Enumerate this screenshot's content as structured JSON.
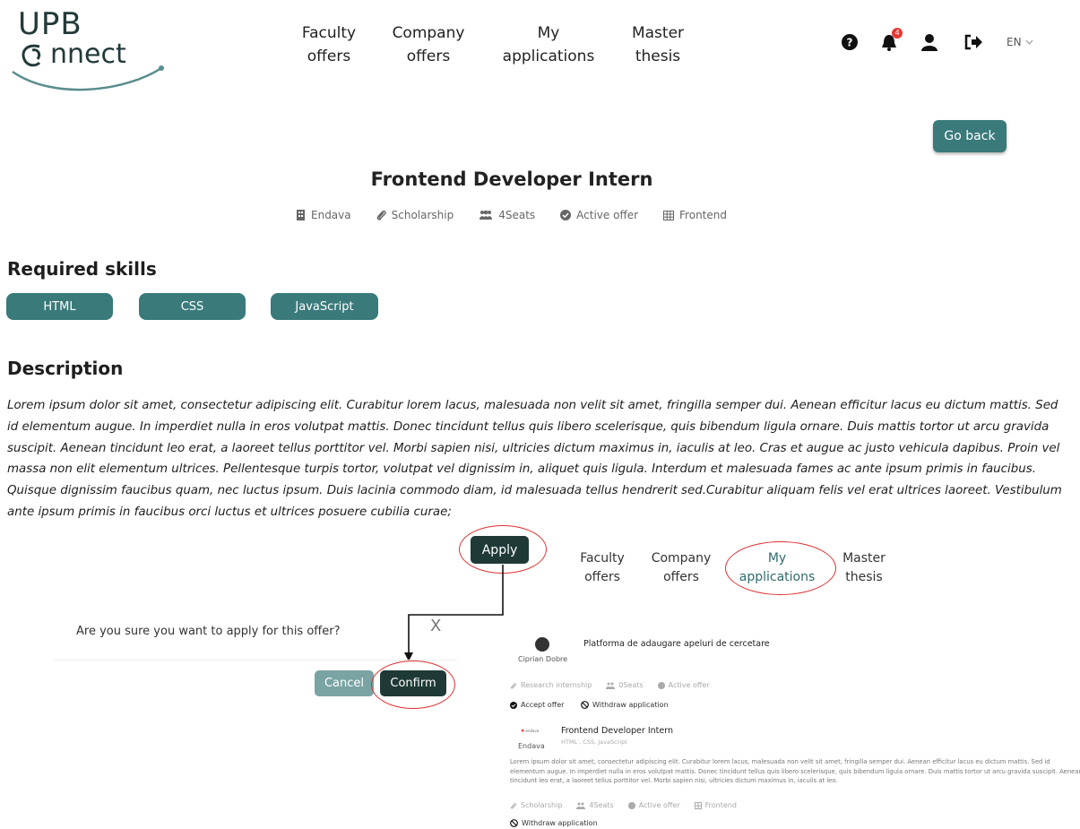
{
  "logo": {
    "line1": "UPB",
    "line2": "nnect"
  },
  "nav": [
    {
      "line1": "Faculty",
      "line2": "offers"
    },
    {
      "line1": "Company",
      "line2": "offers"
    },
    {
      "line1": "My",
      "line2": "applications"
    },
    {
      "line1": "Master",
      "line2": "thesis"
    }
  ],
  "header": {
    "notification_count": "4",
    "language": "EN"
  },
  "go_back_label": "Go back",
  "offer": {
    "title": "Frontend Developer Intern",
    "company": "Endava",
    "type": "Scholarship",
    "seats": "4Seats",
    "status": "Active offer",
    "category": "Frontend"
  },
  "skills": {
    "heading": "Required skills",
    "items": [
      "HTML",
      "CSS",
      "JavaScript"
    ]
  },
  "description": {
    "heading": "Description",
    "text": "Lorem ipsum dolor sit amet, consectetur adipiscing elit. Curabitur lorem lacus, malesuada non velit sit amet, fringilla semper dui. Aenean efficitur lacus eu dictum mattis. Sed id elementum augue. In imperdiet nulla in eros volutpat mattis. Donec tincidunt tellus quis libero scelerisque, quis bibendum ligula ornare. Duis mattis tortor ut arcu gravida suscipit. Aenean tincidunt leo erat, a laoreet tellus porttitor vel. Morbi sapien nisi, ultricies dictum maximus in, iaculis at leo. Cras et augue ac justo vehicula dapibus. Proin vel massa non elit elementum ultrices. Pellentesque turpis tortor, volutpat vel dignissim in, aliquet quis ligula. Interdum et malesuada fames ac ante ipsum primis in faucibus. Quisque dignissim faucibus quam, nec luctus ipsum. Duis lacinia commodo diam, id malesuada tellus hendrerit sed.Curabitur aliquam felis vel erat ultrices laoreet. Vestibulum ante ipsum primis in faucibus orci luctus et ultrices posuere cubilia curae;"
  },
  "apply_label": "Apply",
  "modal": {
    "question": "Are you sure you want to apply for this offer?",
    "close": "X",
    "cancel": "Cancel",
    "confirm": "Confirm"
  },
  "applications": [
    {
      "title": "Platforma de adaugare apeluri de cercetare",
      "owner": "Ciprian Dobre",
      "tags": [
        "Research internship",
        "0Seats",
        "Active offer"
      ],
      "actions": [
        "Accept offer",
        "Withdraw application"
      ]
    },
    {
      "title": "Frontend Developer Intern",
      "owner": "Endava",
      "logo_text": "endava",
      "skills": "HTML , CSS, JavaScript",
      "description": "Lorem ipsum dolor sit amet, consectetur adipiscing elit. Curabitur lorem lacus, malesuada non velit sit amet, fringilla semper dui. Aenean efficitur lacus eu dictum mattis. Sed id elementum augue. In imperdiet nulla in eros volutpat mattis. Donec tincidunt tellus quis libero scelerisque, quis bibendum ligula ornare. Duis mattis tortor ut arcu gravida suscipit. Aenean tincidunt leo erat, a laoreet tellus porttitor vel. Morbi sapien nisi, ultricies dictum maximus in, iaculis at leo.",
      "tags": [
        "Scholarship",
        "4Seats",
        "Active offer",
        "Frontend"
      ],
      "actions": [
        "Withdraw application"
      ]
    }
  ],
  "colors": {
    "teal": "#3a7a7a",
    "dark_teal": "#1f3a36",
    "highlight_red": "#e03030",
    "badge_red": "#e53935"
  }
}
